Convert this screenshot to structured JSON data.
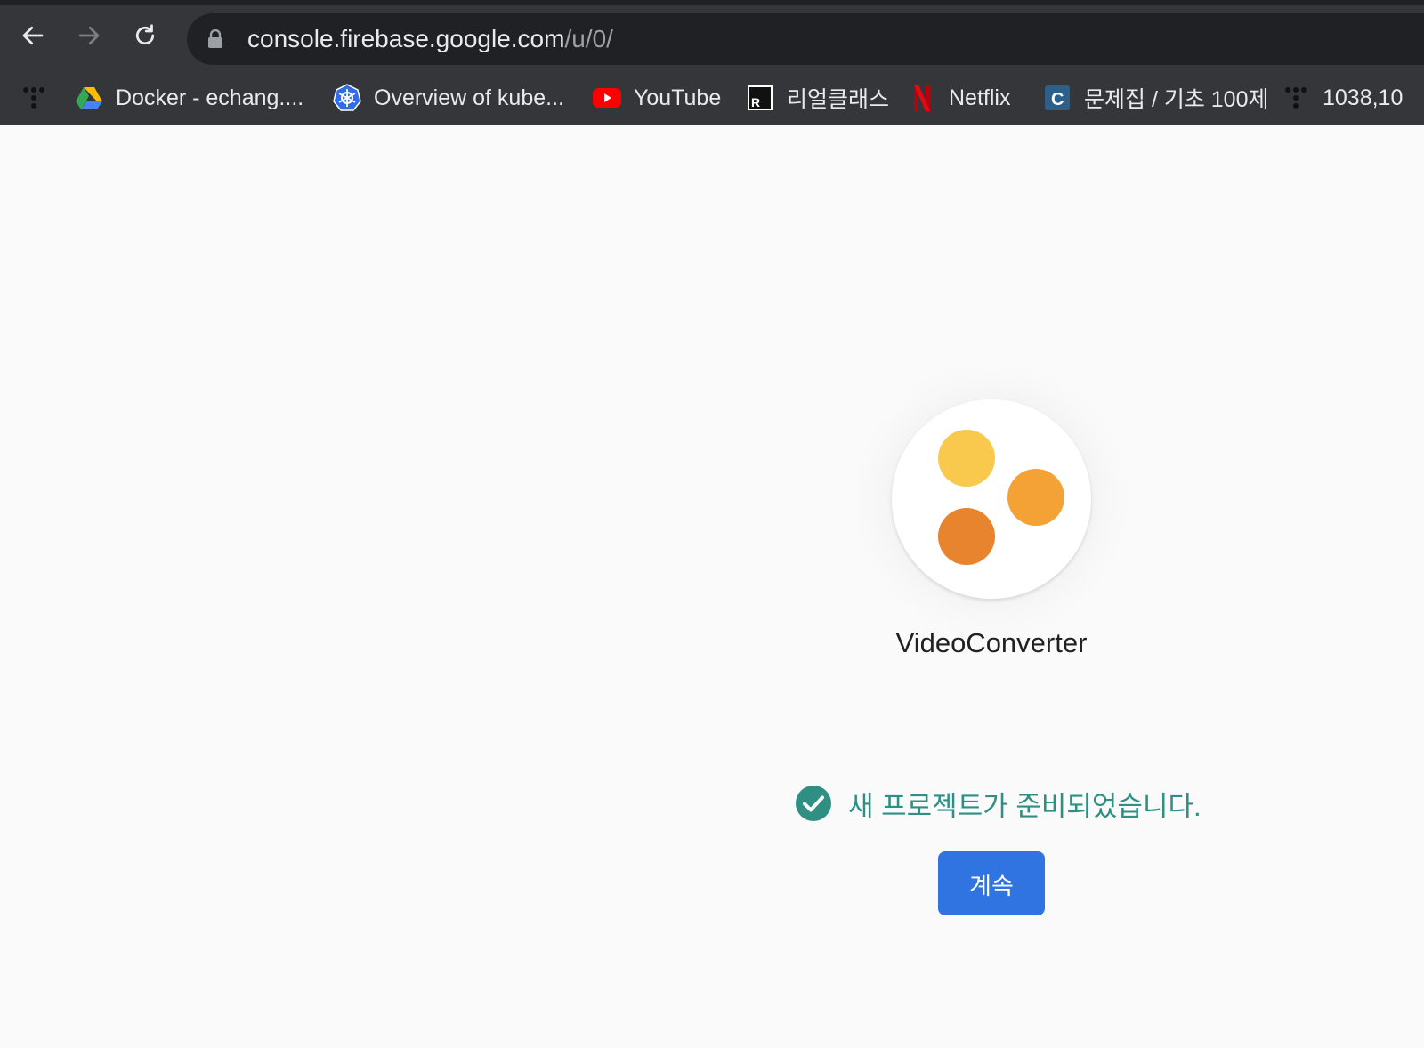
{
  "browser": {
    "url_host": "console.firebase.google.com",
    "url_path": "/u/0/",
    "bookmarks": [
      {
        "icon": "apps-dots-icon",
        "label": ""
      },
      {
        "icon": "google-drive-icon",
        "label": "Docker - echang...."
      },
      {
        "icon": "kubernetes-icon",
        "label": "Overview of kube..."
      },
      {
        "icon": "youtube-icon",
        "label": "YouTube"
      },
      {
        "icon": "realclass-icon",
        "label": "리얼클래스"
      },
      {
        "icon": "netflix-icon",
        "label": "Netflix"
      },
      {
        "icon": "codeup-icon",
        "label": "문제집 / 기초 100제"
      },
      {
        "icon": "apps-dots-icon",
        "label": "1038,10"
      }
    ]
  },
  "project": {
    "name": "VideoConverter",
    "colors": [
      "#f8c94d",
      "#f4a235",
      "#e8832e"
    ]
  },
  "status": {
    "message": "새 프로젝트가 준비되었습니다.",
    "color": "#2f8f83"
  },
  "actions": {
    "continue_label": "계속",
    "color": "#2f74e0"
  }
}
